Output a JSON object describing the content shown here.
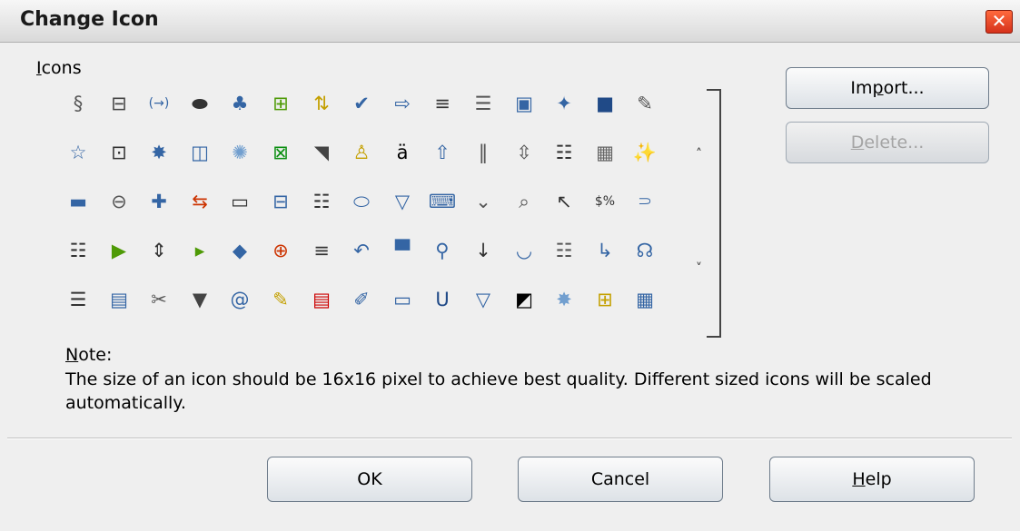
{
  "dialog": {
    "title": "Change Icon",
    "close_glyph": "✕"
  },
  "icons_section": {
    "label_prefix": "I",
    "label_rest": "cons"
  },
  "icon_rows": [
    [
      "script-icon",
      "text-field-icon",
      "arrow-bracket-icon",
      "oval-icon",
      "puzzle-icon",
      "table-icon",
      "sort-icon",
      "spellcheck-icon",
      "right-arrow-icon",
      "align-justify-icon",
      "align-lines-icon",
      "frame-icon",
      "four-point-star-icon",
      "square-icon",
      "user-edit-icon"
    ],
    [
      "star-icon",
      "media-button-icon",
      "burst-icon",
      "calendar-icon",
      "seal-icon",
      "close-box-icon",
      "slash-icon",
      "text-effect-icon",
      "abc-icon",
      "up-arrow-icon",
      "column-split-icon",
      "row-height-icon",
      "form-icon",
      "form-design-icon",
      "magic-wand-icon"
    ],
    [
      "rounded-rect-icon",
      "nav-bar-icon",
      "cross-icon",
      "rotate-icon",
      "line-field-icon",
      "save-icon",
      "list-box-icon",
      "stadium-icon",
      "funnel-down-icon",
      "monitor-icon",
      "chevron-icon",
      "zoom-page-icon",
      "pointer-icon",
      "currency-percent-icon",
      "bracket-icon"
    ],
    [
      "report-icon",
      "run-macro-icon",
      "spin-button-icon",
      "play-icon",
      "diamond-icon",
      "grid-fit-icon",
      "text-lines-icon",
      "undo-curve-icon",
      "picture-icon",
      "filter-icon",
      "down-arrow-icon",
      "smile-curve-icon",
      "data-form-icon",
      "return-arrow-icon",
      "find-user-icon"
    ],
    [
      "paragraph-icon",
      "panel-icon",
      "cut-icon",
      "down-triangle-icon",
      "at-swirl-icon",
      "folder-edit-icon",
      "pdf-icon",
      "pen-icon",
      "ole-icon",
      "underline-icon",
      "down-triangle-outline-icon",
      "mask-icon",
      "sun-icon",
      "table-grid-icon",
      "calendar-grid-icon"
    ]
  ],
  "icon_glyphs": [
    [
      "§",
      "⊟",
      "(→)",
      "⬬",
      "♣",
      "⊞",
      "⇅",
      "✔",
      "⇨",
      "≡",
      "☰",
      "▣",
      "✦",
      "■",
      "✎"
    ],
    [
      "☆",
      "⊡",
      "✸",
      "◫",
      "✺",
      "⊠",
      "◥",
      "♙",
      "ä",
      "⇧",
      "‖",
      "⇳",
      "☷",
      "▦",
      "✨"
    ],
    [
      "▬",
      "⊖",
      "✚",
      "⇆",
      "▭",
      "⊟",
      "☷",
      "⬭",
      "▽",
      "⌨",
      "⌄",
      "⌕",
      "↖",
      "$%",
      "⸧"
    ],
    [
      "☷",
      "▶",
      "⇕",
      "▸",
      "◆",
      "⊕",
      "≡",
      "↶",
      "▀",
      "⚲",
      "↓",
      "◡",
      "☷",
      "↳",
      "☊"
    ],
    [
      "☰",
      "▤",
      "✂",
      "▼",
      "@",
      "✎",
      "▤",
      "✐",
      "▭",
      "U",
      "▽",
      "◩",
      "✸",
      "⊞",
      "▦"
    ]
  ],
  "icon_colors": [
    [
      "#555",
      "#444",
      "#3465a4",
      "#333",
      "#3465a4",
      "#4e9a06",
      "#c4a000",
      "#3465a4",
      "#3465a4",
      "#333",
      "#555",
      "#3465a4",
      "#3465a4",
      "#204a87",
      "#555"
    ],
    [
      "#3465a4",
      "#333",
      "#3465a4",
      "#3465a4",
      "#729fcf",
      "#0c8f12",
      "#444",
      "#c4a000",
      "#000",
      "#3465a4",
      "#555",
      "#555",
      "#333",
      "#666",
      "#777"
    ],
    [
      "#3465a4",
      "#555",
      "#3465a4",
      "#cc3300",
      "#333",
      "#3465a4",
      "#333",
      "#3465a4",
      "#3465a4",
      "#3465a4",
      "#555",
      "#555",
      "#333",
      "#333",
      "#3465a4"
    ],
    [
      "#333",
      "#4e9a06",
      "#333",
      "#4e9a06",
      "#3465a4",
      "#cc3300",
      "#333",
      "#3465a4",
      "#3465a4",
      "#3465a4",
      "#333",
      "#3465a4",
      "#555",
      "#3465a4",
      "#3465a4"
    ],
    [
      "#333",
      "#3465a4",
      "#555",
      "#444",
      "#3465a4",
      "#c4a000",
      "#cc0000",
      "#3465a4",
      "#3465a4",
      "#204a87",
      "#3465a4",
      "#000",
      "#729fcf",
      "#c4a000",
      "#3465a4"
    ]
  ],
  "scrollbar": {
    "up_glyph": "˄",
    "down_glyph": "˅"
  },
  "buttons": {
    "import_prefix": "Im",
    "import_underline": "p",
    "import_rest": "ort...",
    "delete_underline": "D",
    "delete_rest": "elete...",
    "ok": "OK",
    "cancel": "Cancel",
    "help_underline": "H",
    "help_rest": "elp"
  },
  "note": {
    "title_underline": "N",
    "title_rest": "ote:",
    "text": "The size of an icon should be 16x16 pixel to achieve best quality. Different sized icons will be scaled automatically."
  }
}
